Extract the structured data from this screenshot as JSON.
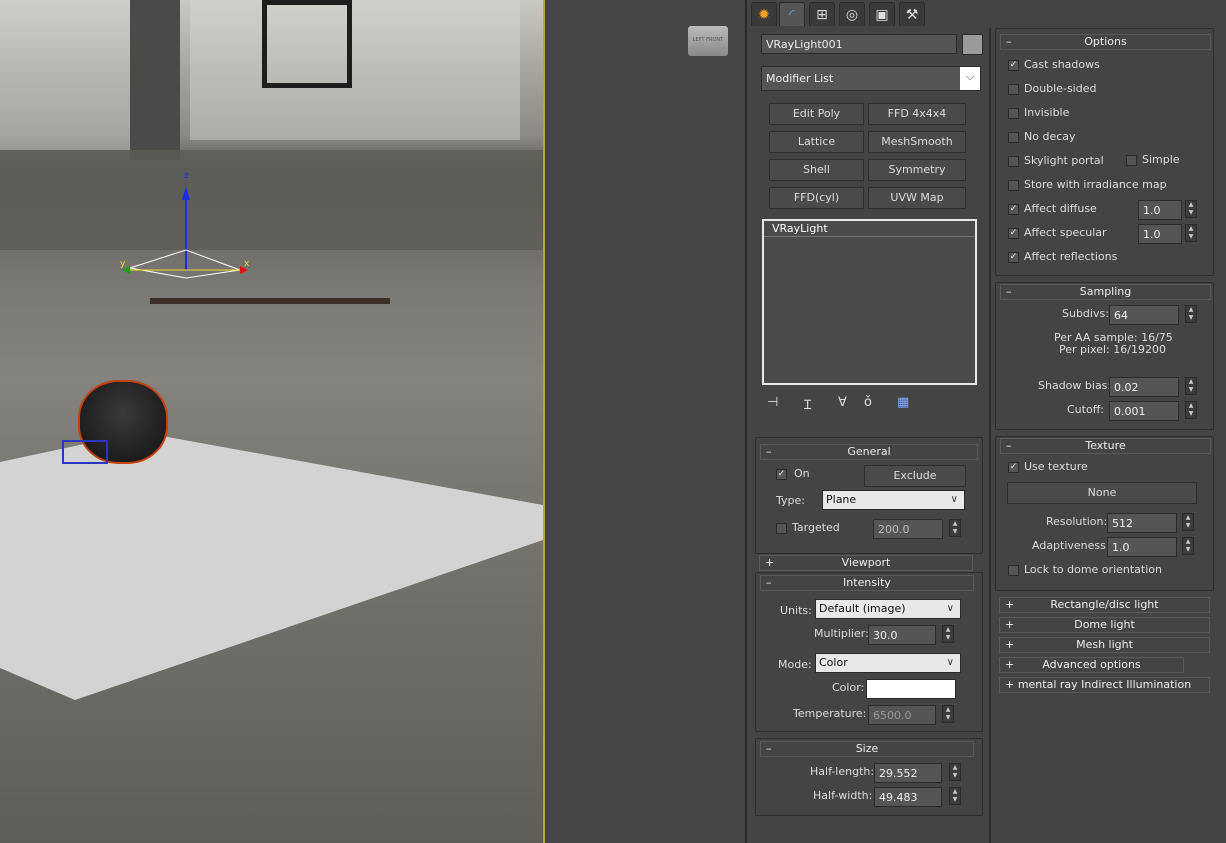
{
  "tabs": [
    {
      "icon": "create-icon",
      "glyph": "✹"
    },
    {
      "icon": "modify-icon",
      "glyph": "◜"
    },
    {
      "icon": "hierarchy-icon",
      "glyph": "⊞"
    },
    {
      "icon": "motion-icon",
      "glyph": "◎"
    },
    {
      "icon": "display-icon",
      "glyph": "▣"
    },
    {
      "icon": "utilities-icon",
      "glyph": "⚒"
    }
  ],
  "object_name": "VRayLight001",
  "object_color": "#9a9a9a",
  "modifier_list": "Modifier List",
  "modifier_buttons": [
    "Edit Poly",
    "FFD 4x4x4",
    "Lattice",
    "MeshSmooth",
    "Shell",
    "Symmetry",
    "FFD(cyl)",
    "UVW Map"
  ],
  "stack_item": "VRayLight",
  "viewport": {
    "navcube": "LEFT FRONT",
    "gizmo_axes": {
      "x": "x",
      "y": "y",
      "z": "z"
    }
  },
  "general": {
    "title": "General",
    "on_label": "On",
    "on": true,
    "exclude": "Exclude",
    "type_label": "Type:",
    "type": "Plane",
    "targeted_label": "Targeted",
    "targeted": false,
    "target_value": "200.0"
  },
  "viewport_roll": {
    "title": "Viewport"
  },
  "intensity": {
    "title": "Intensity",
    "units_label": "Units:",
    "units": "Default (image)",
    "multiplier_label": "Multiplier:",
    "multiplier": "30.0",
    "mode_label": "Mode:",
    "mode": "Color",
    "color_label": "Color:",
    "color": "#ffffff",
    "temperature_label": "Temperature:",
    "temperature": "6500.0"
  },
  "size": {
    "title": "Size",
    "half_length_label": "Half-length:",
    "half_length": "29.552",
    "half_width_label": "Half-width:",
    "half_width": "49.483"
  },
  "options": {
    "title": "Options",
    "items": [
      {
        "label": "Cast shadows",
        "checked": true
      },
      {
        "label": "Double-sided",
        "checked": false
      },
      {
        "label": "Invisible",
        "checked": false
      },
      {
        "label": "No decay",
        "checked": false
      },
      {
        "label": "Skylight portal",
        "checked": false
      },
      {
        "label": "Store with irradiance map",
        "checked": false
      },
      {
        "label": "Affect diffuse",
        "checked": true,
        "value": "1.0"
      },
      {
        "label": "Affect specular",
        "checked": true,
        "value": "1.0"
      },
      {
        "label": "Affect reflections",
        "checked": true
      }
    ],
    "simple_label": "Simple",
    "simple": false
  },
  "sampling": {
    "title": "Sampling",
    "subdivs_label": "Subdivs:",
    "subdivs": "64",
    "per_aa": "Per AA sample: 16/75",
    "per_pixel": "Per pixel: 16/19200",
    "shadow_bias_label": "Shadow bias:",
    "shadow_bias": "0.02",
    "cutoff_label": "Cutoff:",
    "cutoff": "0.001"
  },
  "texture": {
    "title": "Texture",
    "use_texture_label": "Use texture",
    "use_texture": true,
    "map": "None",
    "resolution_label": "Resolution:",
    "resolution": "512",
    "adaptiveness_label": "Adaptiveness:",
    "adaptiveness": "1.0",
    "lock_label": "Lock to dome orientation",
    "lock": false
  },
  "collapsed": [
    "Rectangle/disc light",
    "Dome light",
    "Mesh light",
    "Advanced options",
    "mental ray Indirect Illumination"
  ]
}
